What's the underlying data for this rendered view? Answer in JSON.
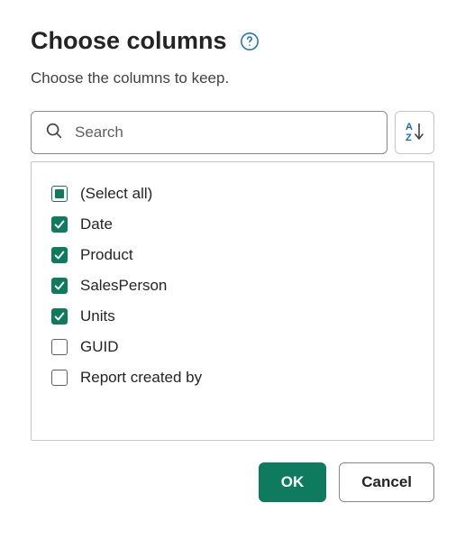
{
  "header": {
    "title": "Choose columns",
    "subtitle": "Choose the columns to keep."
  },
  "search": {
    "placeholder": "Search",
    "value": ""
  },
  "icons": {
    "help": "help-circle",
    "search": "search",
    "sort": "sort-az"
  },
  "colors": {
    "accent": "#0f7b5e",
    "help": "#0f6cbd"
  },
  "columns": {
    "select_all_label": "(Select all)",
    "select_all_state": "indeterminate",
    "items": [
      {
        "label": "Date",
        "checked": true
      },
      {
        "label": "Product",
        "checked": true
      },
      {
        "label": "SalesPerson",
        "checked": true
      },
      {
        "label": "Units",
        "checked": true
      },
      {
        "label": "GUID",
        "checked": false
      },
      {
        "label": "Report created by",
        "checked": false
      }
    ]
  },
  "footer": {
    "ok_label": "OK",
    "cancel_label": "Cancel"
  }
}
